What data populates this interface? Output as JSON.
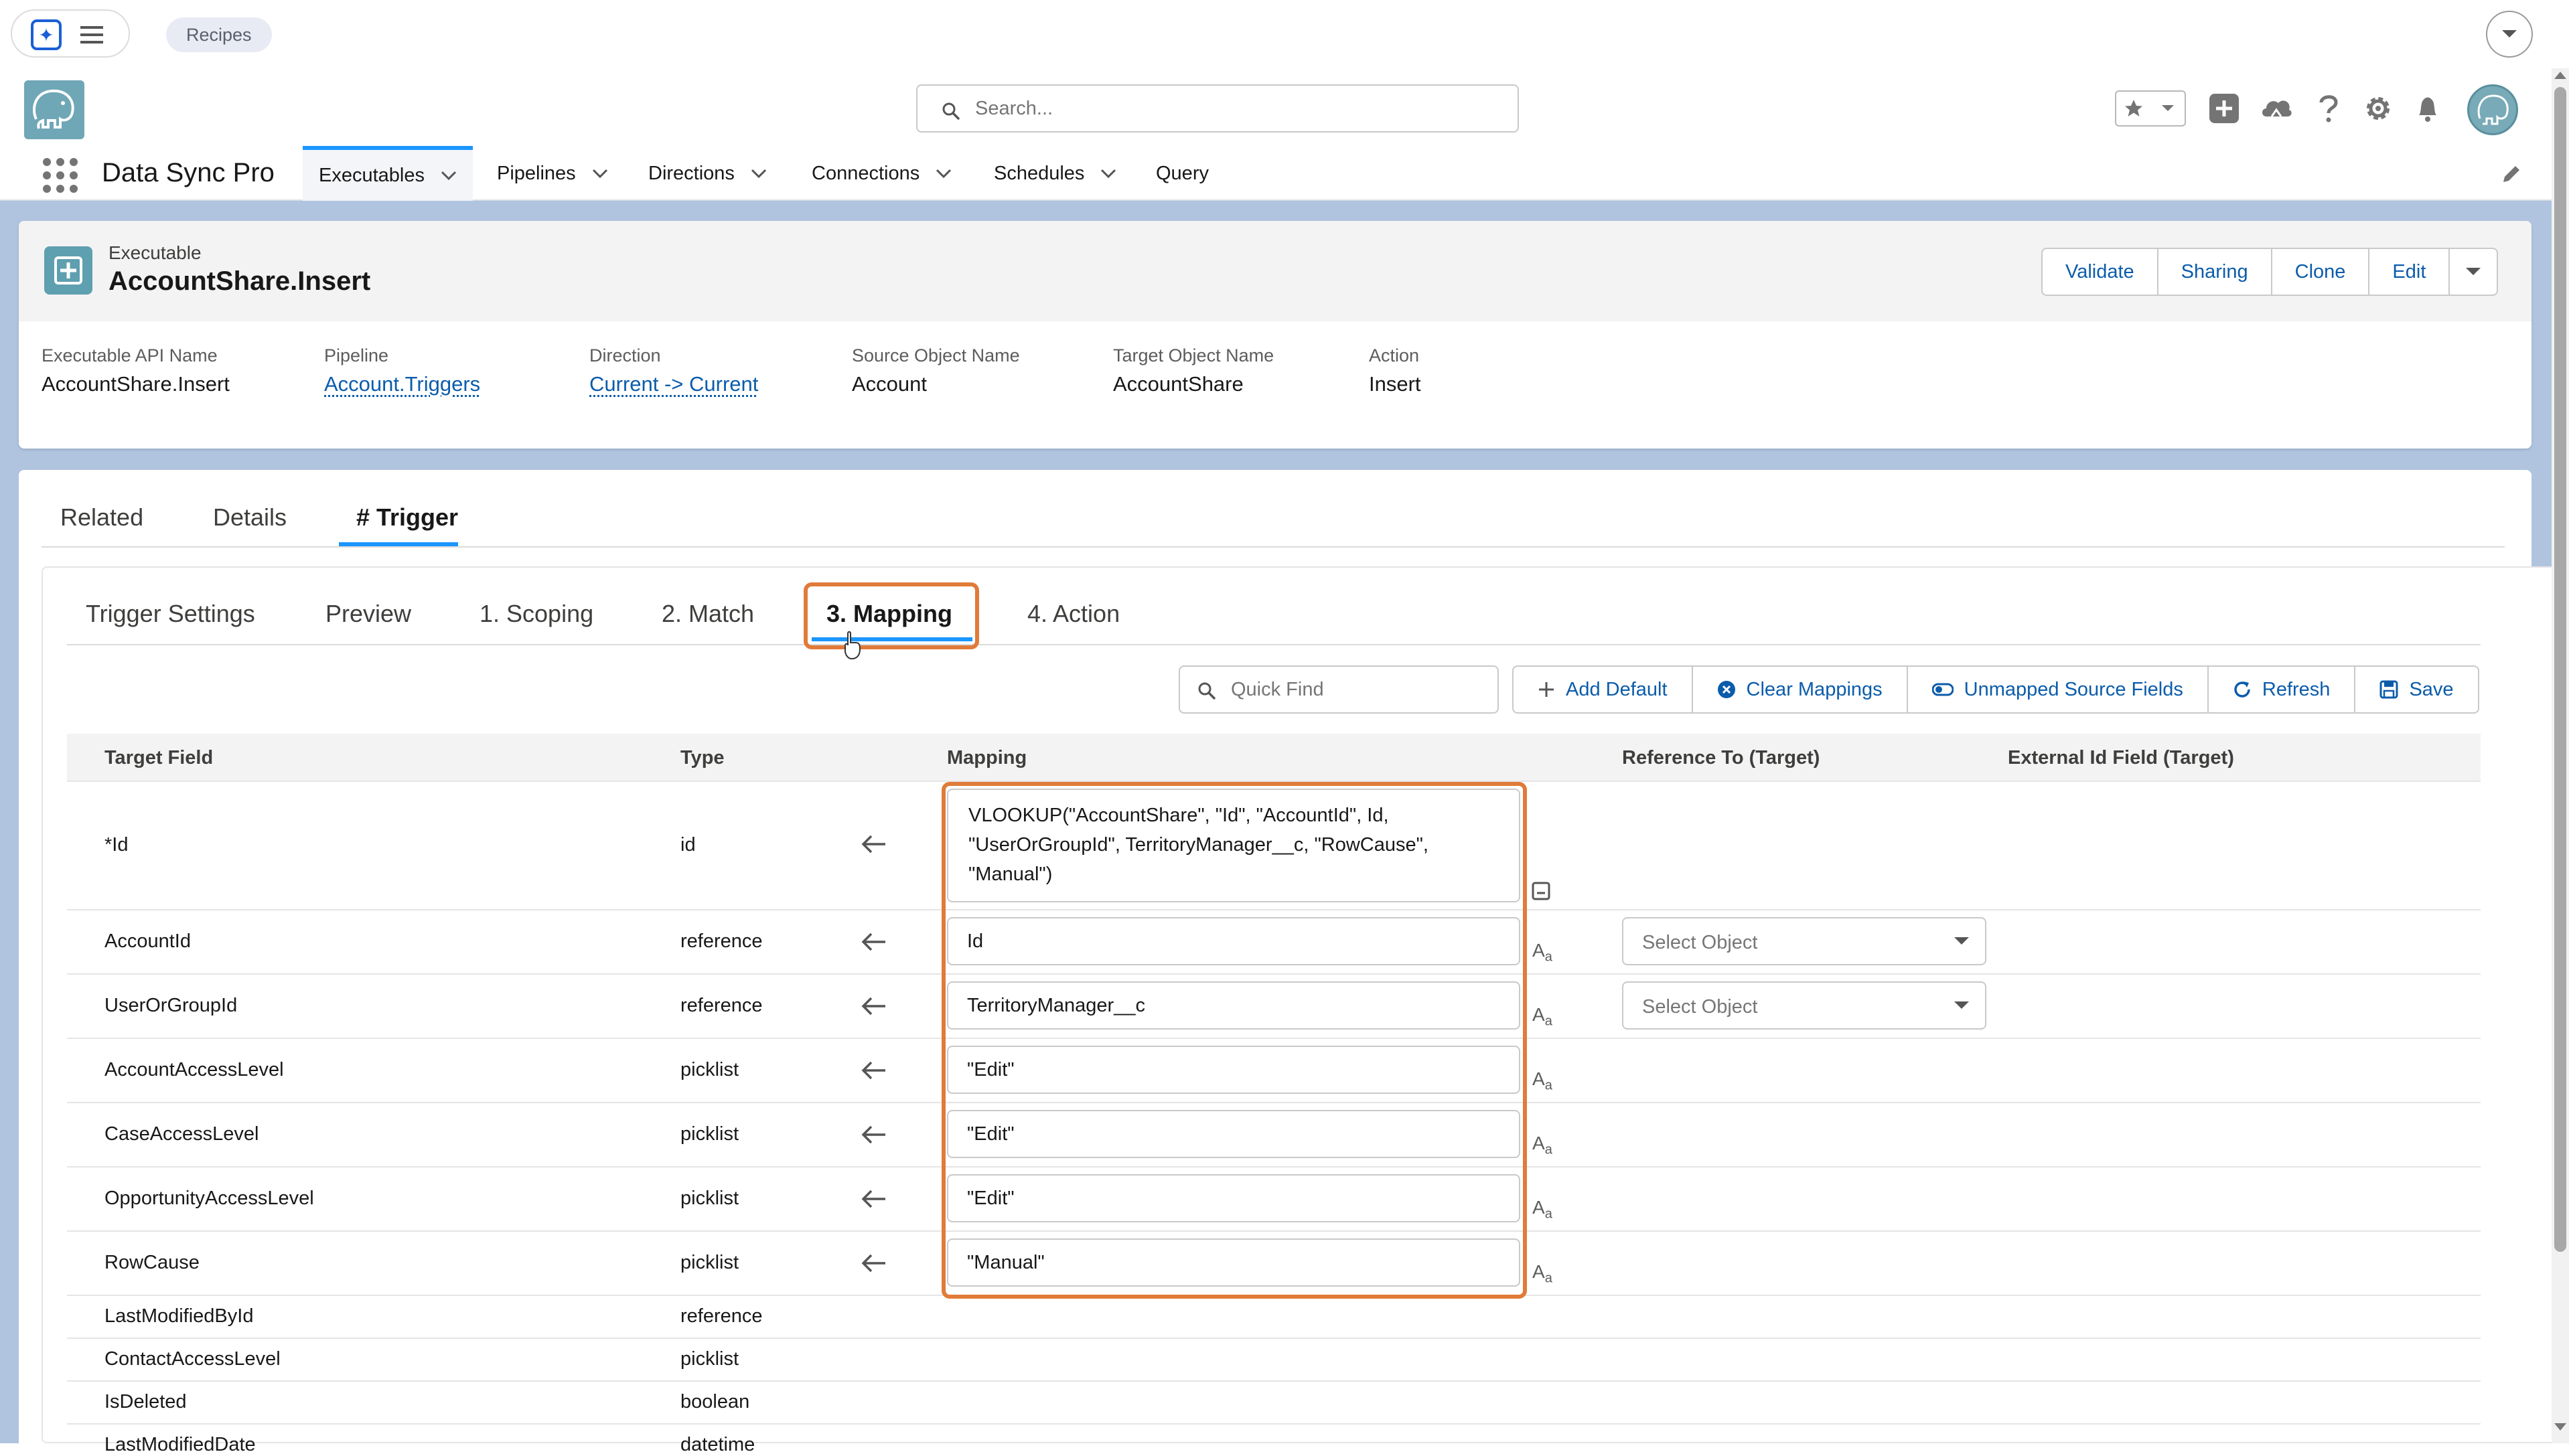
{
  "browser": {
    "tab_label": "Recipes"
  },
  "header": {
    "search_placeholder": "Search..."
  },
  "nav": {
    "app_name": "Data Sync Pro",
    "tabs": [
      {
        "label": "Executables"
      },
      {
        "label": "Pipelines"
      },
      {
        "label": "Directions"
      },
      {
        "label": "Connections"
      },
      {
        "label": "Schedules"
      },
      {
        "label": "Query"
      }
    ]
  },
  "record": {
    "type": "Executable",
    "name": "AccountShare.Insert",
    "buttons": [
      "Validate",
      "Sharing",
      "Clone",
      "Edit"
    ],
    "fields": [
      {
        "label": "Executable API Name",
        "value": "AccountShare.Insert"
      },
      {
        "label": "Pipeline",
        "value": "Account.Triggers"
      },
      {
        "label": "Direction",
        "value": "Current -> Current"
      },
      {
        "label": "Source Object Name",
        "value": "Account"
      },
      {
        "label": "Target Object Name",
        "value": "AccountShare"
      },
      {
        "label": "Action",
        "value": "Insert"
      }
    ]
  },
  "record_tabs": [
    "Related",
    "Details",
    "# Trigger"
  ],
  "trigger_tabs": [
    "Trigger Settings",
    "Preview",
    "1. Scoping",
    "2. Match",
    "3. Mapping",
    "4. Action"
  ],
  "toolbar": {
    "quick_find_placeholder": "Quick Find",
    "buttons": [
      "Add Default",
      "Clear Mappings",
      "Unmapped Source Fields",
      "Refresh",
      "Save"
    ]
  },
  "table": {
    "headers": [
      "Target Field",
      "Type",
      "Mapping",
      "Reference To (Target)",
      "External Id Field (Target)"
    ],
    "select_placeholder": "Select Object",
    "rows": [
      {
        "field": "*Id",
        "type": "id",
        "mapping": "VLOOKUP(\"AccountShare\", \"Id\", \"AccountId\", Id,\n\"UserOrGroupId\", TerritoryManager__c, \"RowCause\",\n\"Manual\")"
      },
      {
        "field": "AccountId",
        "type": "reference",
        "mapping": "Id"
      },
      {
        "field": "UserOrGroupId",
        "type": "reference",
        "mapping": "TerritoryManager__c"
      },
      {
        "field": "AccountAccessLevel",
        "type": "picklist",
        "mapping": "\"Edit\""
      },
      {
        "field": "CaseAccessLevel",
        "type": "picklist",
        "mapping": "\"Edit\""
      },
      {
        "field": "OpportunityAccessLevel",
        "type": "picklist",
        "mapping": "\"Edit\""
      },
      {
        "field": "RowCause",
        "type": "picklist",
        "mapping": "\"Manual\""
      },
      {
        "field": "LastModifiedById",
        "type": "reference",
        "mapping": ""
      },
      {
        "field": "ContactAccessLevel",
        "type": "picklist",
        "mapping": ""
      },
      {
        "field": "IsDeleted",
        "type": "boolean",
        "mapping": ""
      },
      {
        "field": "LastModifiedDate",
        "type": "datetime",
        "mapping": ""
      }
    ]
  },
  "colors": {
    "accent": "#1b96ff",
    "link": "#0b5cab",
    "highlight": "#e07b39",
    "page_bg": "#b0c4df"
  }
}
